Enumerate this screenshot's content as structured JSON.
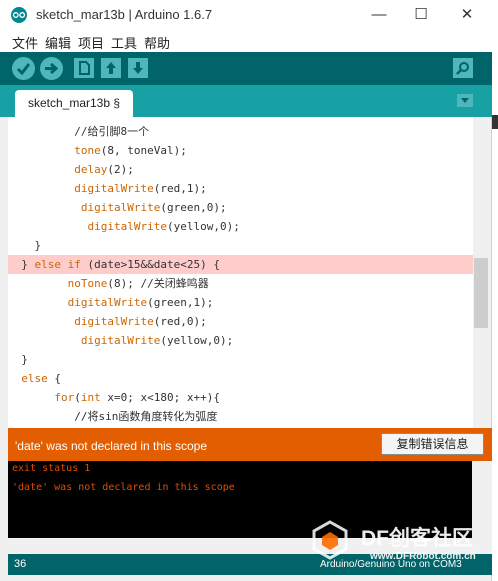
{
  "window": {
    "title": "sketch_mar13b | Arduino 1.6.7",
    "minimize": "—",
    "maximize": "☐",
    "close": "✕"
  },
  "menu": [
    "文件",
    "编辑",
    "项目",
    "工具",
    "帮助"
  ],
  "toolbar": {
    "buttons": [
      "verify-icon",
      "upload-icon",
      "new-icon",
      "open-icon",
      "save-icon",
      "serial-monitor-icon"
    ],
    "colors": {
      "background": "#006468",
      "button": "#4db7bb"
    }
  },
  "tab": {
    "label": "sketch_mar13b §"
  },
  "code_lines": [
    "          //给引脚8一个",
    "          tone(8, toneVal);",
    "          delay(2);",
    "          digitalWrite(red,1);",
    "           digitalWrite(green,0);",
    "            digitalWrite(yellow,0);",
    "    }",
    "  } else if (date>15&&date<25) {",
    "         noTone(8); //关闭蜂鸣器",
    "         digitalWrite(green,1);",
    "          digitalWrite(red,0);",
    "           digitalWrite(yellow,0);",
    "  }",
    "  else {",
    "       for(int x=0; x<180; x++){",
    "          //将sin函数角度转化为弧度"
  ],
  "highlighted_line": 7,
  "message": {
    "text": "'date' was not declared in this scope",
    "copy_button": "复制错误信息",
    "color": "#e35e00"
  },
  "console": [
    "exit status 1",
    "'date' was not declared in this scope"
  ],
  "status": {
    "line": "36",
    "board": "Arduino/Genuino Uno on COM3"
  },
  "watermark": {
    "name": "DF创客社区",
    "url": "www.DFRobot.com.cn"
  }
}
